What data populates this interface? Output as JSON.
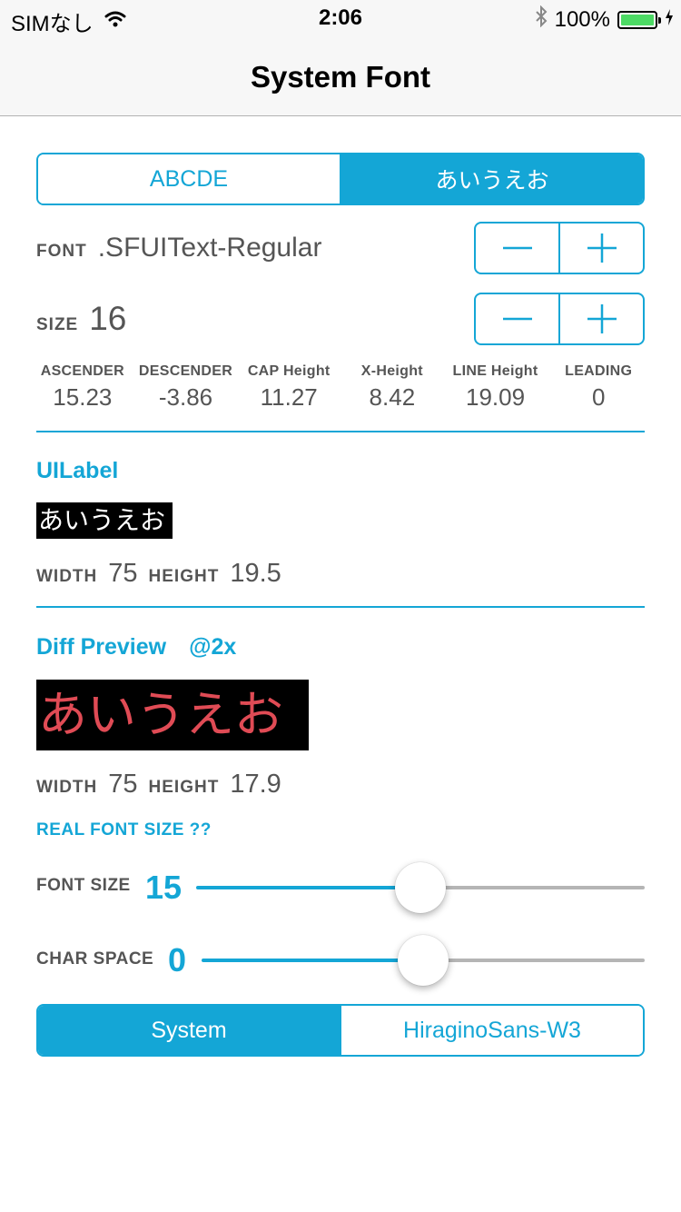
{
  "status_bar": {
    "carrier": "SIMなし",
    "time": "2:06",
    "battery_percent": "100%",
    "battery_level": 1.0,
    "icons": [
      "wifi-icon",
      "bluetooth-icon",
      "battery-icon",
      "charging-icon"
    ]
  },
  "nav": {
    "title": "System Font"
  },
  "text_segment": {
    "options": [
      "ABCDE",
      "あいうえお"
    ],
    "selected_index": 1
  },
  "font_row": {
    "label": "FONT",
    "value": ".SFUIText-Regular",
    "minus": "−",
    "plus": "+"
  },
  "size_row": {
    "label": "SIZE",
    "value": "16",
    "minus": "−",
    "plus": "+"
  },
  "metrics": [
    {
      "label": "ASCENDER",
      "value": "15.23"
    },
    {
      "label": "DESCENDER",
      "value": "-3.86"
    },
    {
      "label": "CAP Height",
      "value": "11.27"
    },
    {
      "label": "X-Height",
      "value": "8.42"
    },
    {
      "label": "LINE Height",
      "value": "19.09"
    },
    {
      "label": "LEADING",
      "value": "0"
    }
  ],
  "uilabel": {
    "title": "UILabel",
    "preview_text": "あいうえお",
    "width_label": "WIDTH",
    "width_value": "75",
    "height_label": "HEIGHT",
    "height_value": "19.5"
  },
  "diff_preview": {
    "title": "Diff Preview",
    "scale": "@2x",
    "preview_text": "あいうえお",
    "width_label": "WIDTH",
    "width_value": "75",
    "height_label": "HEIGHT",
    "height_value": "17.9"
  },
  "real_font_size_link": "REAL FONT SIZE ??",
  "font_size_slider": {
    "label": "FONT SIZE",
    "value": "15",
    "fraction": 0.5
  },
  "char_space_slider": {
    "label": "CHAR SPACE",
    "value": "0",
    "fraction": 0.5
  },
  "font_segment": {
    "options": [
      "System",
      "HiraginoSans-W3"
    ],
    "selected_index": 0
  },
  "colors": {
    "accent": "#14a6d6",
    "track_inactive": "#b5b5b5",
    "diff_text": "#e04b55",
    "battery": "#4cd964"
  }
}
